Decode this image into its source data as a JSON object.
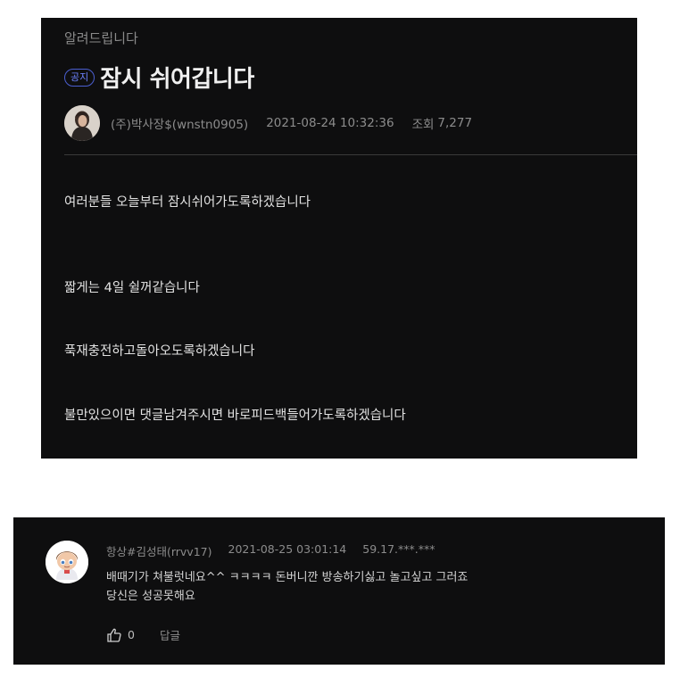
{
  "post": {
    "category": "알려드립니다",
    "badge": "공지",
    "title": "잠시 쉬어갑니다",
    "author": "(주)박사장$(wnstn0905)",
    "datetime": "2021-08-24 10:32:36",
    "views_label": "조회",
    "views": "7,277",
    "body": [
      "여러분들 오늘부터 잠시쉬어가도록하겠습니다",
      "짧게는 4일  쉴꺼같습니다",
      "푹재충전하고돌아오도록하겠습니다",
      "불만있으이면 댓글남겨주시면 바로피드백들어가도록하겠습니다"
    ]
  },
  "comment": {
    "author": "항상#김성태(rrvv17)",
    "datetime": "2021-08-25 03:01:14",
    "ip": "59.17.***.***",
    "lines": [
      "배때기가 쳐불럿네요^^ ㅋㅋㅋㅋ 돈버니깐 방송하기싫고 놀고싶고 그러죠",
      "당신은 성공못해요"
    ],
    "likes": "0",
    "reply_label": "답글"
  },
  "colors": {
    "panel_bg": "#0e0e0f",
    "badge_accent": "#4b5fd1"
  },
  "icons": {
    "like": "thumbs-up-icon"
  }
}
